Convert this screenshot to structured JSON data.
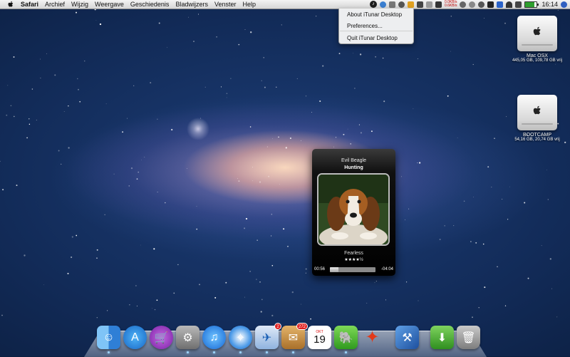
{
  "menubar": {
    "app_name": "Safari",
    "items": [
      "Archief",
      "Wijzig",
      "Weergave",
      "Geschiedenis",
      "Bladwijzers",
      "Venster",
      "Help"
    ],
    "clock": "16:14",
    "net_up": "0.0KB/s",
    "net_down": "0.6KB/s"
  },
  "dropdown": {
    "items": [
      "About iTunar Desktop",
      "Preferences...",
      "Quit iTunar Desktop"
    ]
  },
  "drives": [
    {
      "name": "Mac OSX",
      "info": "445,05 GB, 109,78 GB vrij"
    },
    {
      "name": "BOOTCAMP",
      "info": "54,16 GB, 20,74 GB vrij"
    }
  ],
  "widget": {
    "artist": "Evil Beagle",
    "track": "Hunting",
    "album": "Fearless",
    "rating": "★★★★½",
    "elapsed": "00:56",
    "remaining": "-04:04",
    "progress": 0.19
  },
  "dock": {
    "calendar_month": "OKT",
    "calendar_day": "19",
    "mail_badge": "2",
    "package_badge": "272",
    "items": [
      {
        "name": "finder-icon"
      },
      {
        "name": "app-store-icon"
      },
      {
        "name": "itunes-store-icon"
      },
      {
        "name": "system-preferences-icon"
      },
      {
        "name": "itunes-icon"
      },
      {
        "name": "safari-icon"
      },
      {
        "name": "mail-icon"
      },
      {
        "name": "package-icon"
      },
      {
        "name": "calendar-icon"
      },
      {
        "name": "evernote-icon"
      },
      {
        "name": "flashcard-icon"
      },
      {
        "name": "xcode-icon"
      },
      {
        "name": "downloads-folder-icon"
      },
      {
        "name": "trash-icon"
      }
    ]
  }
}
